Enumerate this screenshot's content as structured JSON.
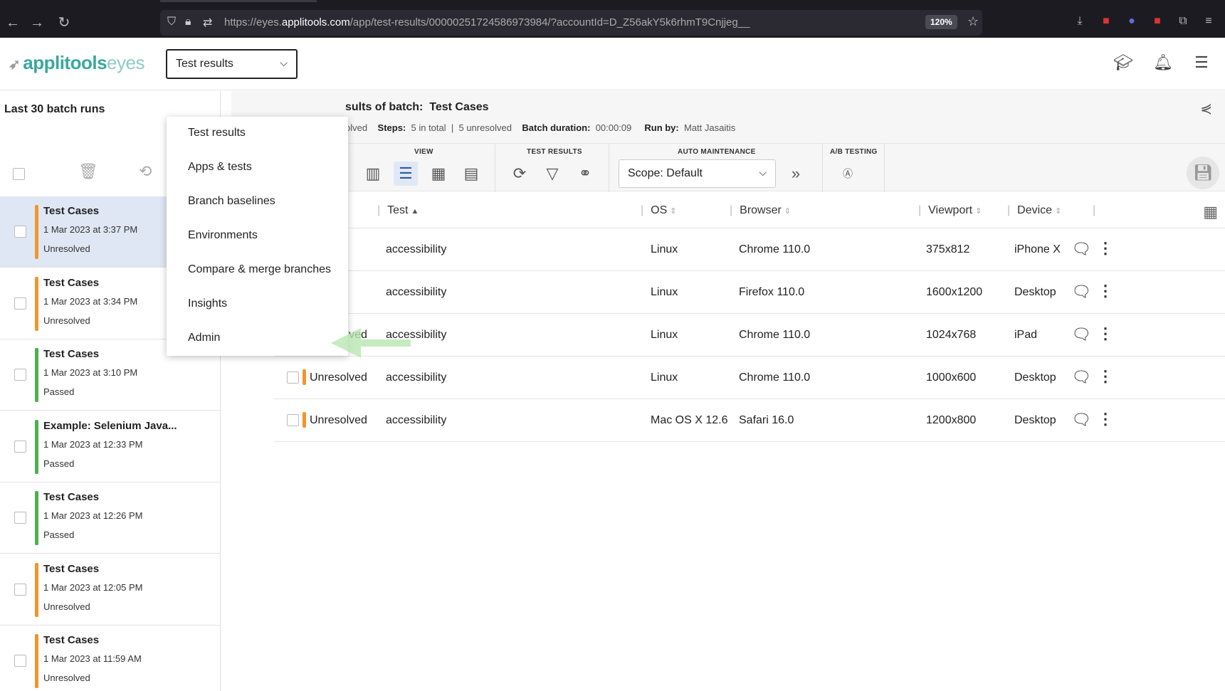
{
  "browser": {
    "url_prefix": "https://eyes.",
    "url_domain": "applitools.com",
    "url_rest": "/app/test-results/00000251724586973984/?accountId=D_Z56akY5k6rhmT9Cnjjeg__",
    "zoom": "120%"
  },
  "app": {
    "logo_main": "applitools",
    "logo_sub": "eyes",
    "page_select": "Test results"
  },
  "menu": {
    "items": [
      "Test results",
      "Apps & tests",
      "Branch baselines",
      "Environments",
      "Compare & merge branches",
      "Insights",
      "Admin"
    ]
  },
  "sidebar": {
    "title": "Last 30 batch runs",
    "batches": [
      {
        "name": "Test Cases",
        "date": "1 Mar 2023 at 3:37 PM",
        "status": "Unresolved",
        "color": "#f0962c"
      },
      {
        "name": "Test Cases",
        "date": "1 Mar 2023 at 3:34 PM",
        "status": "Unresolved",
        "color": "#f0962c"
      },
      {
        "name": "Test Cases",
        "date": "1 Mar 2023 at 3:10 PM",
        "status": "Passed",
        "color": "#4caf50"
      },
      {
        "name": "Example: Selenium Java...",
        "date": "1 Mar 2023 at 12:33 PM",
        "status": "Passed",
        "color": "#4caf50"
      },
      {
        "name": "Test Cases",
        "date": "1 Mar 2023 at 12:26 PM",
        "status": "Passed",
        "color": "#4caf50"
      },
      {
        "name": "Test Cases",
        "date": "1 Mar 2023 at 12:05 PM",
        "status": "Unresolved",
        "color": "#f0962c"
      },
      {
        "name": "Test Cases",
        "date": "1 Mar 2023 at 11:59 AM",
        "status": "Unresolved",
        "color": "#f0962c"
      }
    ]
  },
  "batch": {
    "title_prefix": "sults of batch:",
    "title_name": "Test Cases",
    "meta_status": "olved",
    "steps_label": "Steps:",
    "steps_total": "5 in total",
    "steps_unresolved": "5 unresolved",
    "duration_label": "Batch duration:",
    "duration": "00:00:09",
    "runby_label": "Run by:",
    "runby": "Matt Jasaitis"
  },
  "toolbar": {
    "view_label": "VIEW",
    "results_label": "TEST RESULTS",
    "maint_label": "AUTO MAINTENANCE",
    "ab_label": "A/B TESTING",
    "scope": "Scope: Default"
  },
  "table": {
    "headers": [
      "Test",
      "OS",
      "Browser",
      "Viewport",
      "Device"
    ],
    "rows": [
      {
        "status": "",
        "test": "accessibility",
        "os": "Linux",
        "browser": "Chrome 110.0",
        "viewport": "375x812",
        "device": "iPhone X"
      },
      {
        "status": "",
        "test": "accessibility",
        "os": "Linux",
        "browser": "Firefox 110.0",
        "viewport": "1600x1200",
        "device": "Desktop"
      },
      {
        "status": "Unresolved",
        "test": "accessibility",
        "os": "Linux",
        "browser": "Chrome 110.0",
        "viewport": "1024x768",
        "device": "iPad"
      },
      {
        "status": "Unresolved",
        "test": "accessibility",
        "os": "Linux",
        "browser": "Chrome 110.0",
        "viewport": "1000x600",
        "device": "Desktop"
      },
      {
        "status": "Unresolved",
        "test": "accessibility",
        "os": "Mac OS X 12.6",
        "browser": "Safari 16.0",
        "viewport": "1200x800",
        "device": "Desktop"
      }
    ]
  },
  "colors": {
    "accent": "#3aa89c",
    "unresolved": "#f0962c",
    "passed": "#4caf50",
    "selected_row": "#dfe7f4"
  }
}
